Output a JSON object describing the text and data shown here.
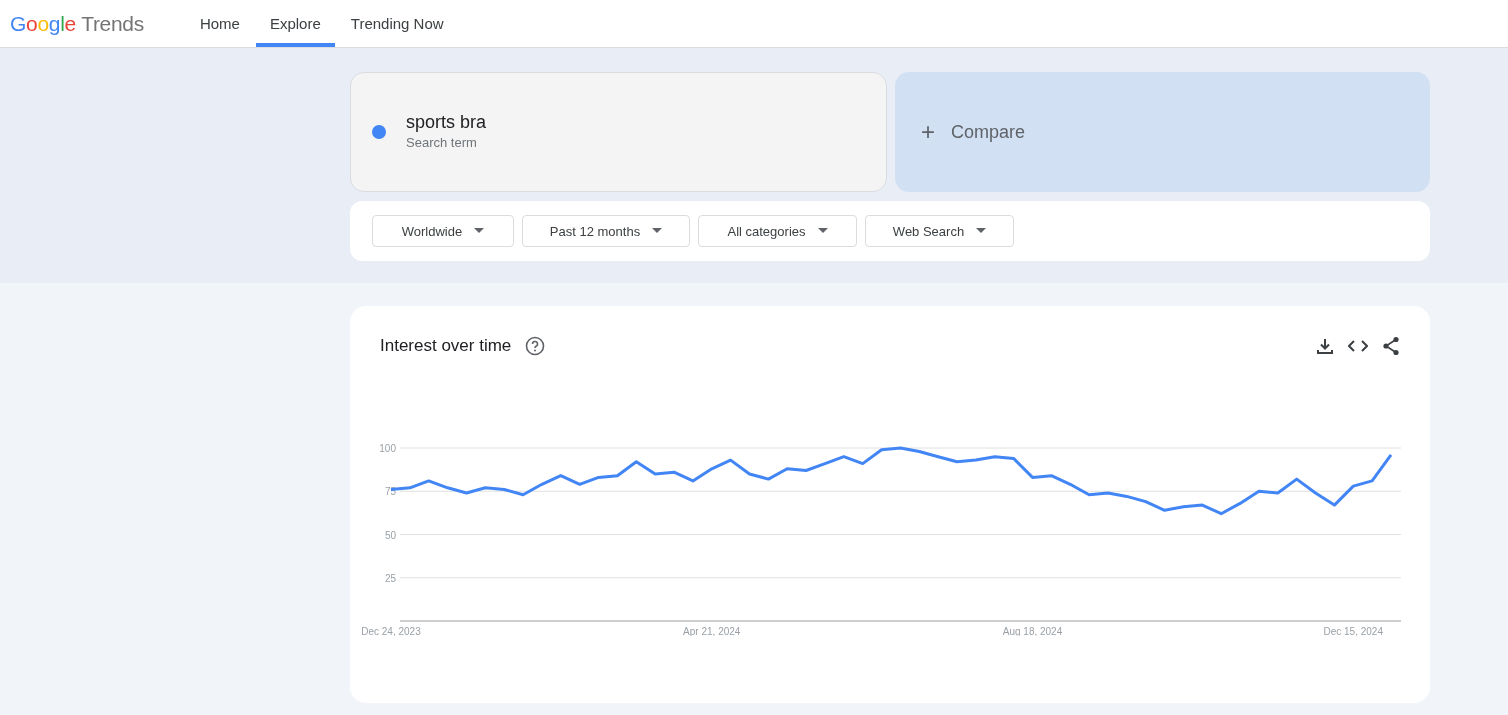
{
  "header": {
    "logo": {
      "brand": "Google",
      "product": "Trends"
    },
    "nav": [
      {
        "label": "Home",
        "selected": false
      },
      {
        "label": "Explore",
        "selected": true
      },
      {
        "label": "Trending Now",
        "selected": false
      }
    ]
  },
  "search": {
    "terms": [
      {
        "term": "sports bra",
        "sublabel": "Search term",
        "color": "#4285f4"
      }
    ],
    "compare": {
      "icon": "+",
      "label": "Compare"
    }
  },
  "filters": [
    {
      "label": "Worldwide"
    },
    {
      "label": "Past 12 months"
    },
    {
      "label": "All categories"
    },
    {
      "label": "Web Search"
    }
  ],
  "interest_over_time": {
    "title": "Interest over time",
    "chart_data": {
      "type": "line",
      "categories": [
        "Dec 24, 2023",
        null,
        null,
        null,
        null,
        null,
        null,
        null,
        null,
        null,
        null,
        null,
        null,
        null,
        null,
        null,
        null,
        "Apr 21, 2024",
        null,
        null,
        null,
        null,
        null,
        null,
        null,
        null,
        null,
        null,
        null,
        null,
        null,
        null,
        null,
        null,
        "Aug 18, 2024",
        null,
        null,
        null,
        null,
        null,
        null,
        null,
        null,
        null,
        null,
        null,
        null,
        null,
        null,
        null,
        null,
        "Dec 15, 2024",
        null,
        null
      ],
      "series": [
        {
          "color": "#4285f4",
          "values": [
            76,
            77,
            81,
            77,
            74,
            77,
            76,
            73,
            79,
            84,
            79,
            83,
            84,
            92,
            85,
            86,
            81,
            88,
            93,
            85,
            82,
            88,
            87,
            91,
            95,
            91,
            99,
            100,
            98,
            95,
            92,
            93,
            95,
            94,
            83,
            84,
            79,
            73,
            74,
            72,
            69,
            64,
            66,
            67,
            62,
            68,
            75,
            74,
            82,
            74,
            67,
            78,
            81,
            96
          ]
        }
      ],
      "ylim": [
        0,
        100
      ],
      "yticks": [
        25,
        50,
        75,
        100
      ],
      "grid": true
    }
  }
}
